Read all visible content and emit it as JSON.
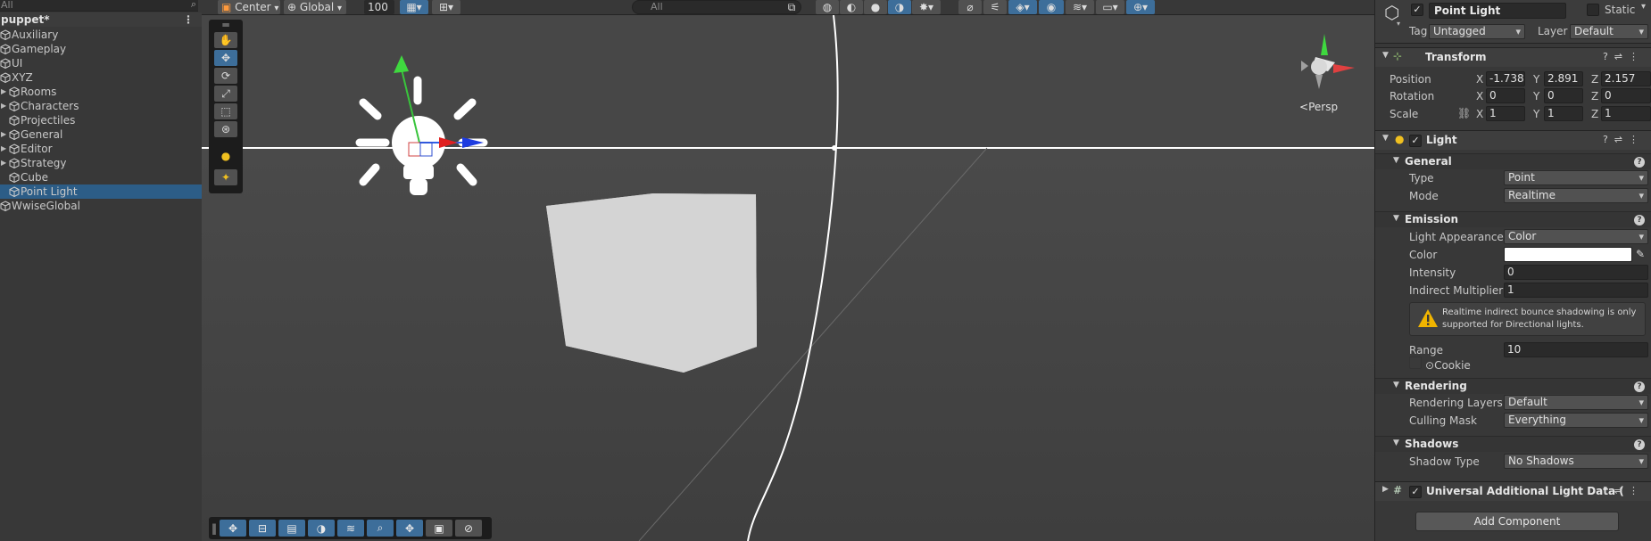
{
  "hierarchy": {
    "search_placeholder": "All",
    "scene_name": "puppet*",
    "items": [
      {
        "label": "Auxiliary",
        "level": 0,
        "expandable": false,
        "selected": false
      },
      {
        "label": "Gameplay",
        "level": 0,
        "expandable": false,
        "selected": false
      },
      {
        "label": "UI",
        "level": 0,
        "expandable": false,
        "selected": false
      },
      {
        "label": "XYZ",
        "level": 0,
        "expandable": false,
        "selected": false
      },
      {
        "label": "Rooms",
        "level": 1,
        "expandable": true,
        "selected": false
      },
      {
        "label": "Characters",
        "level": 1,
        "expandable": true,
        "selected": false
      },
      {
        "label": "Projectiles",
        "level": 1,
        "expandable": false,
        "selected": false
      },
      {
        "label": "General",
        "level": 1,
        "expandable": true,
        "selected": false
      },
      {
        "label": "Editor",
        "level": 1,
        "expandable": true,
        "selected": false
      },
      {
        "label": "Strategy",
        "level": 1,
        "expandable": true,
        "selected": false
      },
      {
        "label": "Cube",
        "level": 1,
        "expandable": false,
        "selected": false
      },
      {
        "label": "Point Light",
        "level": 1,
        "expandable": false,
        "selected": true
      },
      {
        "label": "WwiseGlobal",
        "level": 0,
        "expandable": false,
        "selected": false
      }
    ]
  },
  "scene_view": {
    "toolbar": {
      "pivot_label": "Center",
      "space_label": "Global",
      "grid_value": "100",
      "search_placeholder": "All"
    },
    "camera_mode_label": "Persp"
  },
  "inspector": {
    "object_name": "Point Light",
    "active": true,
    "static_label": "Static",
    "tag_label": "Tag",
    "tag_value": "Untagged",
    "layer_label": "Layer",
    "layer_value": "Default",
    "transform": {
      "title": "Transform",
      "position_label": "Position",
      "rotation_label": "Rotation",
      "scale_label": "Scale",
      "position": {
        "x": "-1.738",
        "y": "2.891",
        "z": "2.157"
      },
      "rotation": {
        "x": "0",
        "y": "0",
        "z": "0"
      },
      "scale": {
        "x": "1",
        "y": "1",
        "z": "1"
      },
      "axis_x": "X",
      "axis_y": "Y",
      "axis_z": "Z"
    },
    "light": {
      "title": "Light",
      "enabled": true,
      "general_section": "General",
      "type_label": "Type",
      "type_value": "Point",
      "mode_label": "Mode",
      "mode_value": "Realtime",
      "emission_section": "Emission",
      "appearance_label": "Light Appearance",
      "appearance_value": "Color",
      "color_label": "Color",
      "color_value": "#ffffff",
      "intensity_label": "Intensity",
      "intensity_value": "0",
      "indirect_label": "Indirect Multiplier",
      "indirect_value": "1",
      "warning_text": "Realtime indirect bounce shadowing is only supported for Directional lights.",
      "range_label": "Range",
      "range_value": "10",
      "cookie_label": "Cookie",
      "rendering_section": "Rendering",
      "rendering_layers_label": "Rendering Layers",
      "rendering_layers_value": "Default",
      "culling_label": "Culling Mask",
      "culling_value": "Everything",
      "shadows_section": "Shadows",
      "shadow_type_label": "Shadow Type",
      "shadow_type_value": "No Shadows"
    },
    "additional_component_title": "Universal Additional Light Data (",
    "add_component_label": "Add Component"
  },
  "colors": {
    "selection": "#2c5d87",
    "panel": "#383838",
    "scene_bg": "#464646",
    "accent_button": "#3d6e9a",
    "warning": "#f0b400"
  }
}
